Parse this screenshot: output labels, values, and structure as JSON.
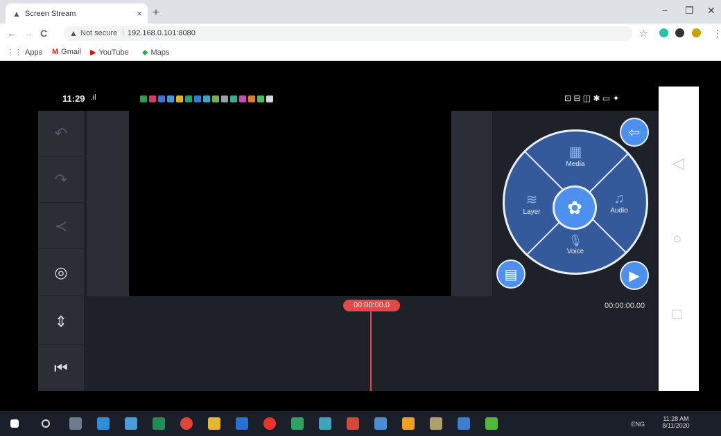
{
  "browser": {
    "tab_title": "Screen Stream",
    "tab_icon": "screen-stream-icon",
    "close_tab": "×",
    "new_tab": "+",
    "win_min": "−",
    "win_max": "❐",
    "win_close": "✕",
    "back": "←",
    "forward": "→",
    "reload": "C",
    "security_icon": "▲",
    "security_text": "Not secure",
    "separator": "|",
    "url": "192.168.0.101:8080",
    "star": "☆",
    "menu": "⋮"
  },
  "bookmarks": [
    {
      "label": "Apps",
      "icon": "⋮⋮",
      "color": "#4285f4"
    },
    {
      "label": "Gmail",
      "icon": "M",
      "color": "#d93025"
    },
    {
      "label": "YouTube",
      "icon": "▶",
      "color": "#ff0000"
    },
    {
      "label": "Maps",
      "icon": "◆",
      "color": "#34a853"
    }
  ],
  "phone": {
    "status_time": "11:29",
    "status_signal": ".ıl ",
    "status_icons_right": "⊡ ⊟ ◫ ✱ ▭ ✦"
  },
  "editor": {
    "undo_icon": "↶",
    "redo_icon": "↷",
    "share_icon": "≺",
    "settings_icon": "◎",
    "split_icon": "⇕",
    "rewind_icon": "⏮",
    "playhead_time": "00:00:00.0",
    "duration": "00:00:00.00",
    "exit_icon": "⇦",
    "play_icon": "▶",
    "store_icon": "▤",
    "hub_icon": "✿"
  },
  "wheel": {
    "media": "Media",
    "audio": "Audio",
    "voice": "Voice",
    "layer": "Layer",
    "media_icon": "▦",
    "audio_icon": "♫",
    "voice_icon": "🎙",
    "layer_icon": "≋"
  },
  "android_nav": {
    "back": "◁",
    "home": "○",
    "recents": "□"
  },
  "tray": {
    "time": "11:28 AM",
    "date": "8/11/2020",
    "lang": "ENG"
  }
}
